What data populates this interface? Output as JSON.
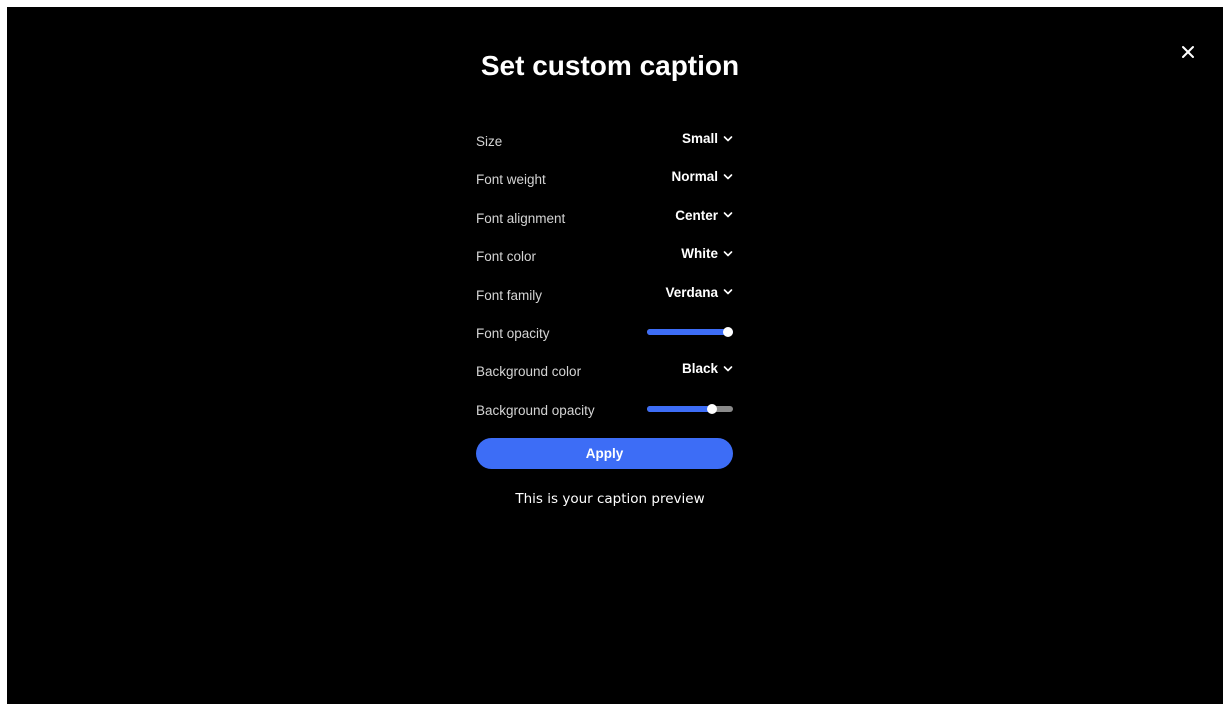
{
  "dialog": {
    "title": "Set custom caption",
    "close_icon": "close-icon"
  },
  "settings": {
    "size": {
      "label": "Size",
      "value": "Small"
    },
    "font_weight": {
      "label": "Font weight",
      "value": "Normal"
    },
    "font_alignment": {
      "label": "Font alignment",
      "value": "Center"
    },
    "font_color": {
      "label": "Font color",
      "value": "White"
    },
    "font_family": {
      "label": "Font family",
      "value": "Verdana"
    },
    "font_opacity": {
      "label": "Font opacity",
      "level": 1.0
    },
    "background_color": {
      "label": "Background color",
      "value": "Black"
    },
    "background_opacity": {
      "label": "Background opacity",
      "level": 0.75
    }
  },
  "apply_label": "Apply",
  "preview_text": "This is your caption preview",
  "colors": {
    "accent": "#3d6df6",
    "background": "#000000",
    "text": "#ffffff",
    "track": "#8a8a8a"
  }
}
